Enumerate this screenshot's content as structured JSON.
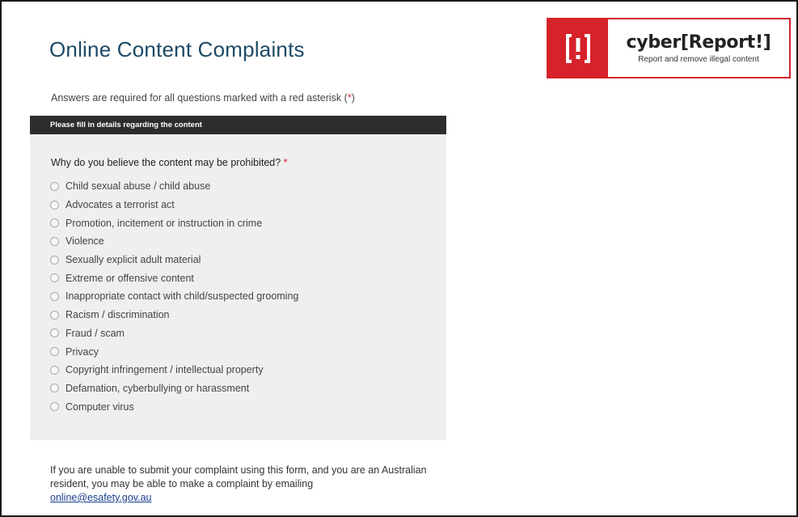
{
  "page": {
    "title": "Online Content Complaints"
  },
  "logo": {
    "brand": "cyber[Report!]",
    "tagline": "Report and remove illegal content"
  },
  "required_note": {
    "text": "Answers are required for all questions marked with a red asterisk (",
    "star": "*",
    "close": ")"
  },
  "section": {
    "header": "Please fill in details regarding the content",
    "question": "Why do you believe the content may be prohibited?",
    "required_star": "*",
    "options": [
      "Child sexual abuse / child abuse",
      "Advocates a terrorist act",
      "Promotion, incitement or instruction in crime",
      "Violence",
      "Sexually explicit adult material",
      "Extreme or offensive content",
      "Inappropriate contact with child/suspected grooming",
      "Racism / discrimination",
      "Fraud / scam",
      "Privacy",
      "Copyright infringement / intellectual property",
      "Defamation, cyberbullying or harassment",
      "Computer virus"
    ]
  },
  "footer": {
    "text": "If you are unable to submit your complaint using this form, and you are an Australian resident, you may be able to make a complaint by emailing",
    "email": "online@esafety.gov.au"
  },
  "icons": {
    "logo_mark": "exclamation-bracket-icon",
    "radio": "radio-unchecked-icon"
  },
  "colors": {
    "brand_red": "#d6222a",
    "title_blue": "#1d4a66",
    "header_dark": "#2d2d2d",
    "panel_grey": "#efefef",
    "link_blue": "#1a3e8c"
  }
}
